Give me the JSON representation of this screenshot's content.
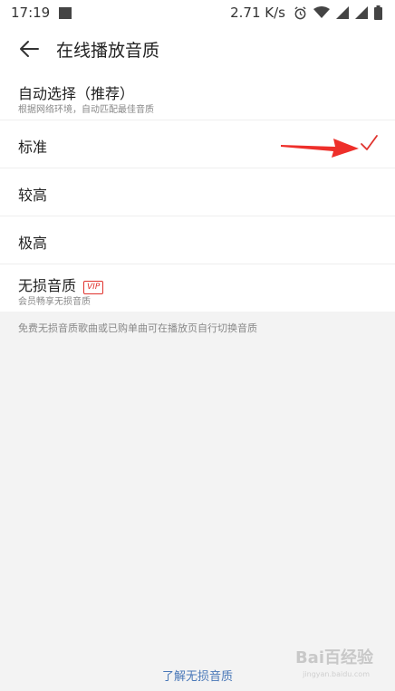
{
  "status_bar": {
    "time": "17:19",
    "network_speed": "2.71 K/s",
    "icons": [
      "gallery-icon",
      "alarm-icon",
      "wifi-icon",
      "signal-icon",
      "signal-icon",
      "battery-icon"
    ]
  },
  "header": {
    "back_icon": "back-arrow-icon",
    "title": "在线播放音质"
  },
  "options": [
    {
      "label": "自动选择（推荐）",
      "sub": "根据网络环境，自动匹配最佳音质",
      "selected": false
    },
    {
      "label": "标准",
      "selected": true
    },
    {
      "label": "较高",
      "selected": false
    },
    {
      "label": "极高",
      "selected": false
    },
    {
      "label": "无损音质",
      "badge": "VIP",
      "sub": "会员畅享无损音质",
      "selected": false
    }
  ],
  "hint": "免费无损音质歌曲或已购单曲可在播放页自行切换音质",
  "footer_link": "了解无损音质",
  "colors": {
    "accent_red": "#e0322d",
    "link_blue": "#4a78b8",
    "background": "#f3f3f3"
  }
}
